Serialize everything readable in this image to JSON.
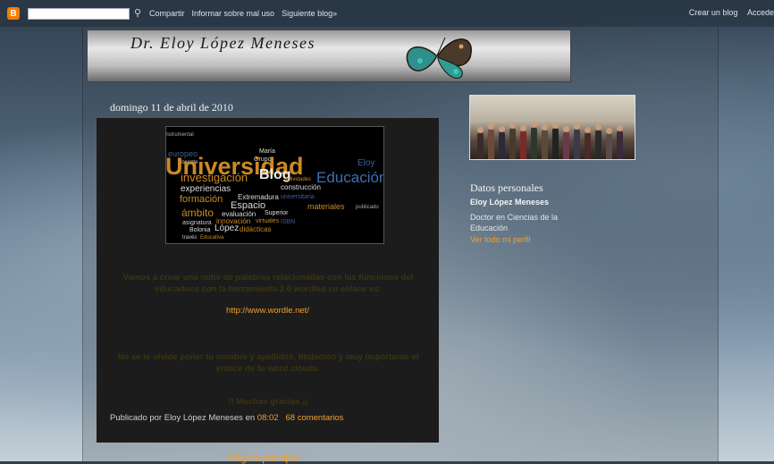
{
  "navbar": {
    "search_placeholder": "",
    "links": [
      "Compartir",
      "Informar sobre mal uso",
      "Siguiente blog»"
    ],
    "right_links": [
      "Crear un blog",
      "Accede"
    ]
  },
  "header": {
    "title": "Dr. Eloy López Meneses"
  },
  "post": {
    "date": "domingo 11 de abril de 2010",
    "paragraph1": "Vamos a crear una nube de palabras relacionadas con las funciones del educaducs con la herramienta 2.0 wordlea su enlace es:",
    "link": "http://www.wordle.net/",
    "paragraph2": "No se te olvide poner tu nombre y apellidos, titulación y muy importante el enlace de tu word clouds.",
    "paragraph3": "!! Muchas gracias ¡¡",
    "footer": {
      "prefix": "Publicado por Eloy López Meneses en",
      "time": "08:02",
      "comments": "68 comentarios"
    },
    "wordcloud_words": {
      "universidad": "Universidad",
      "blog": "Blog",
      "investigacion": "investigación",
      "educacion": "Educación",
      "experiencias": "experiencias",
      "extremadura": "Extremadura",
      "formacion": "formación",
      "espacio": "Espacio",
      "ambito": "ámbito",
      "evaluacion": "evaluación",
      "construccion": "construcción",
      "materiales": "materiales",
      "eloy": "Eloy",
      "lopez": "López",
      "bolonia": "Bolonia",
      "didacticas": "didácticas",
      "asignatura": "asignatura",
      "innovacion": "innovación",
      "superior": "Superior",
      "actividades": "actividades",
      "europeo": "europeo",
      "docente": "docente",
      "grupo": "Grupo",
      "maria": "María",
      "universitaria": "universitaria",
      "publicado": "publicado",
      "traves": "través",
      "educativa": "Educativa",
      "isbn": "ISBN",
      "virtuales": "virtuales",
      "instrumental": "instrumental"
    }
  },
  "sidebar": {
    "section_title": "Datos personales",
    "name": "Eloy López Meneses",
    "description": "Doctor en Ciencias de la Educación",
    "profile_link": "Ver todo mi perfil"
  },
  "home_link": "Página principal"
}
